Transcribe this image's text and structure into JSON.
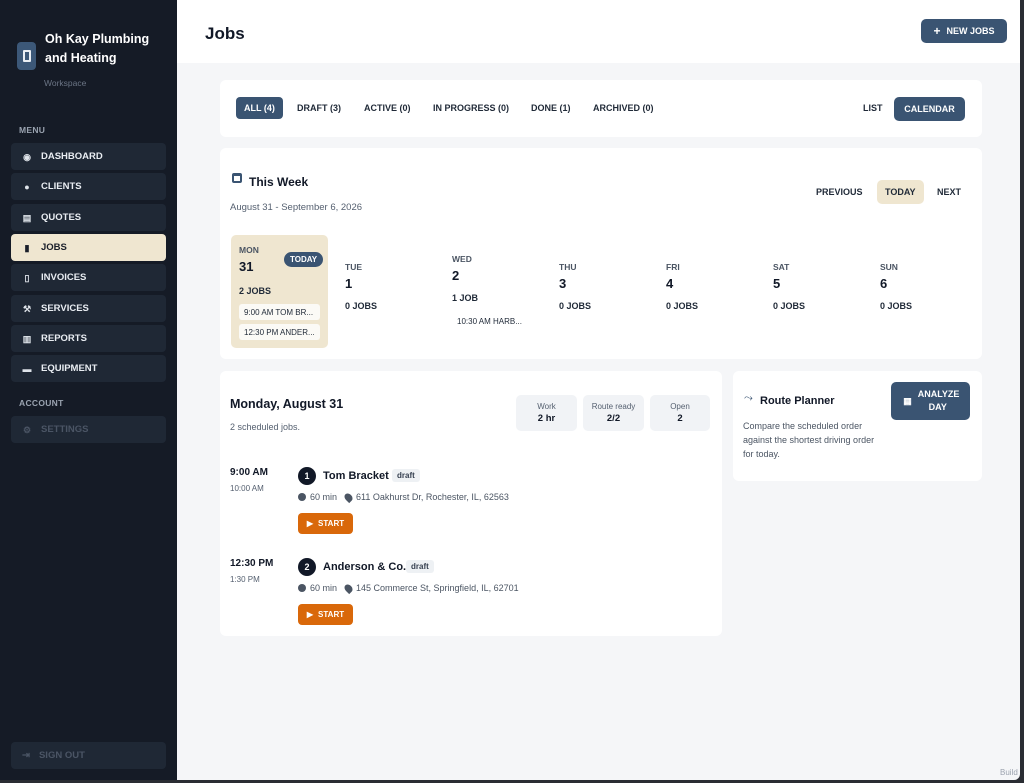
{
  "brand": {
    "name": "Oh Kay Plumbing and Heating",
    "sub": "Workspace"
  },
  "sidebar": {
    "menu_label": "MENU",
    "items": [
      {
        "label": "DASHBOARD",
        "icon": "dashboard-icon"
      },
      {
        "label": "CLIENTS",
        "icon": "user-icon"
      },
      {
        "label": "QUOTES",
        "icon": "quote-icon"
      },
      {
        "label": "JOBS",
        "icon": "clipboard-icon"
      },
      {
        "label": "INVOICES",
        "icon": "invoice-icon"
      },
      {
        "label": "SERVICES",
        "icon": "hammer-icon"
      },
      {
        "label": "REPORTS",
        "icon": "chart-icon"
      },
      {
        "label": "EQUIPMENT",
        "icon": "toolbox-icon"
      }
    ],
    "account_label": "ACCOUNT",
    "settings_label": "SETTINGS",
    "signout_label": "SIGN OUT"
  },
  "header": {
    "title": "Jobs",
    "new_jobs_label": "NEW JOBS"
  },
  "filters": {
    "tabs": [
      "ALL (4)",
      "DRAFT (3)",
      "ACTIVE (0)",
      "IN PROGRESS (0)",
      "DONE (1)",
      "ARCHIVED (0)"
    ],
    "list_label": "LIST",
    "calendar_label": "CALENDAR"
  },
  "week": {
    "title": "This Week",
    "range": "August 31 - September 6, 2026",
    "previous_label": "PREVIOUS",
    "today_label": "TODAY",
    "next_label": "NEXT",
    "today_badge": "TODAY",
    "days": [
      {
        "name": "MON",
        "num": "31",
        "jobs": "2 JOBS",
        "slots": [
          "9:00 AM TOM BR...",
          "12:30 PM ANDER..."
        ]
      },
      {
        "name": "TUE",
        "num": "1",
        "jobs": "0 JOBS"
      },
      {
        "name": "WED",
        "num": "2",
        "jobs": "1 JOB",
        "slots": [
          "10:30 AM HARB..."
        ]
      },
      {
        "name": "THU",
        "num": "3",
        "jobs": "0 JOBS"
      },
      {
        "name": "FRI",
        "num": "4",
        "jobs": "0 JOBS"
      },
      {
        "name": "SAT",
        "num": "5",
        "jobs": "0 JOBS"
      },
      {
        "name": "SUN",
        "num": "6",
        "jobs": "0 JOBS"
      }
    ]
  },
  "detail": {
    "title": "Monday, August 31",
    "subtitle": "2 scheduled jobs.",
    "stats": [
      {
        "label": "Work",
        "value": "2 hr"
      },
      {
        "label": "Route ready",
        "value": "2/2"
      },
      {
        "label": "Open",
        "value": "2"
      }
    ],
    "jobs": [
      {
        "start": "9:00 AM",
        "end": "10:00 AM",
        "num": "1",
        "client": "Tom Bracket",
        "status": "draft",
        "duration": "60 min",
        "address": "611 Oakhurst Dr, Rochester, IL, 62563",
        "action": "START"
      },
      {
        "start": "12:30 PM",
        "end": "1:30 PM",
        "num": "2",
        "client": "Anderson & Co.",
        "status": "draft",
        "duration": "60 min",
        "address": "145 Commerce St, Springfield, IL, 62701",
        "action": "START"
      }
    ]
  },
  "route": {
    "title": "Route Planner",
    "description": "Compare the scheduled order against the shortest driving order for today.",
    "button": "ANALYZE DAY"
  },
  "footer": {
    "build": "Build"
  },
  "colors": {
    "accent": "#3a5472",
    "highlight": "#efe6d0",
    "start": "#d9680a",
    "sidebar": "#151b26"
  }
}
